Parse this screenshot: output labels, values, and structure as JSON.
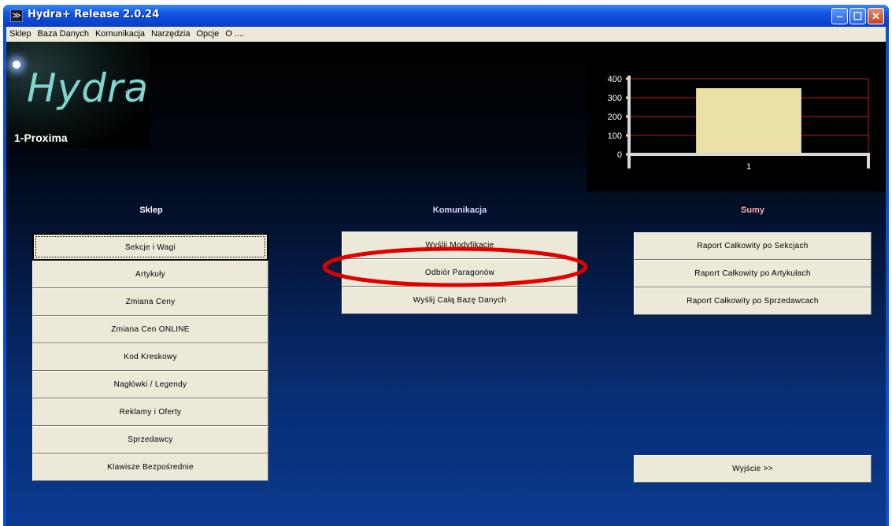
{
  "window": {
    "title": "Hydra+ Release 2.0.24"
  },
  "titlebar_buttons": {
    "minimize": "‒",
    "maximize": "☐",
    "close": "✕"
  },
  "menu": [
    "Sklep",
    "Baza Danych",
    "Komunikacja",
    "Narzędzia",
    "Opcje",
    "O ...."
  ],
  "logo": {
    "text": "Hydra",
    "plus": "+",
    "store": "1-Proxima"
  },
  "chart_data": {
    "type": "bar",
    "categories": [
      "1"
    ],
    "values": [
      350
    ],
    "title": "",
    "xlabel": "",
    "ylabel": "",
    "ylim": [
      0,
      400
    ],
    "yticks": [
      "0",
      "100",
      "200",
      "300",
      "400"
    ],
    "colors": {
      "bar": "#ebe0a5",
      "grid": "#b82020",
      "axis": "#d8d8d8",
      "bg": "#000000"
    }
  },
  "sections": {
    "sklep": {
      "title": "Sklep",
      "color": "#ffffff"
    },
    "komunikacja": {
      "title": "Komunikacja",
      "color": "#d8d8ff"
    },
    "sumy": {
      "title": "Sumy",
      "color": "#ffb0b0"
    }
  },
  "sklep_buttons": [
    "Sekcje i Wagi",
    "Artykuły",
    "Zmiana Ceny",
    "Zmiana Cen ONLINE",
    "Kod Kreskowy",
    "Nagłówki / Legendy",
    "Reklamy i Oferty",
    "Sprzedawcy",
    "Klawisze Bezpośrednie"
  ],
  "komunikacja_buttons": [
    "Wyślij Modyfikacje",
    "Odbiór Paragonów",
    "Wyślij Całą Bazę Danych"
  ],
  "sumy_buttons": [
    "Raport Całkowity po Sekcjach",
    "Raport Całkowity po Artykułach",
    "Raport Całkowity po Sprzedawcach"
  ],
  "exit_button": "Wyjście >>",
  "highlight_color": "#e00000"
}
